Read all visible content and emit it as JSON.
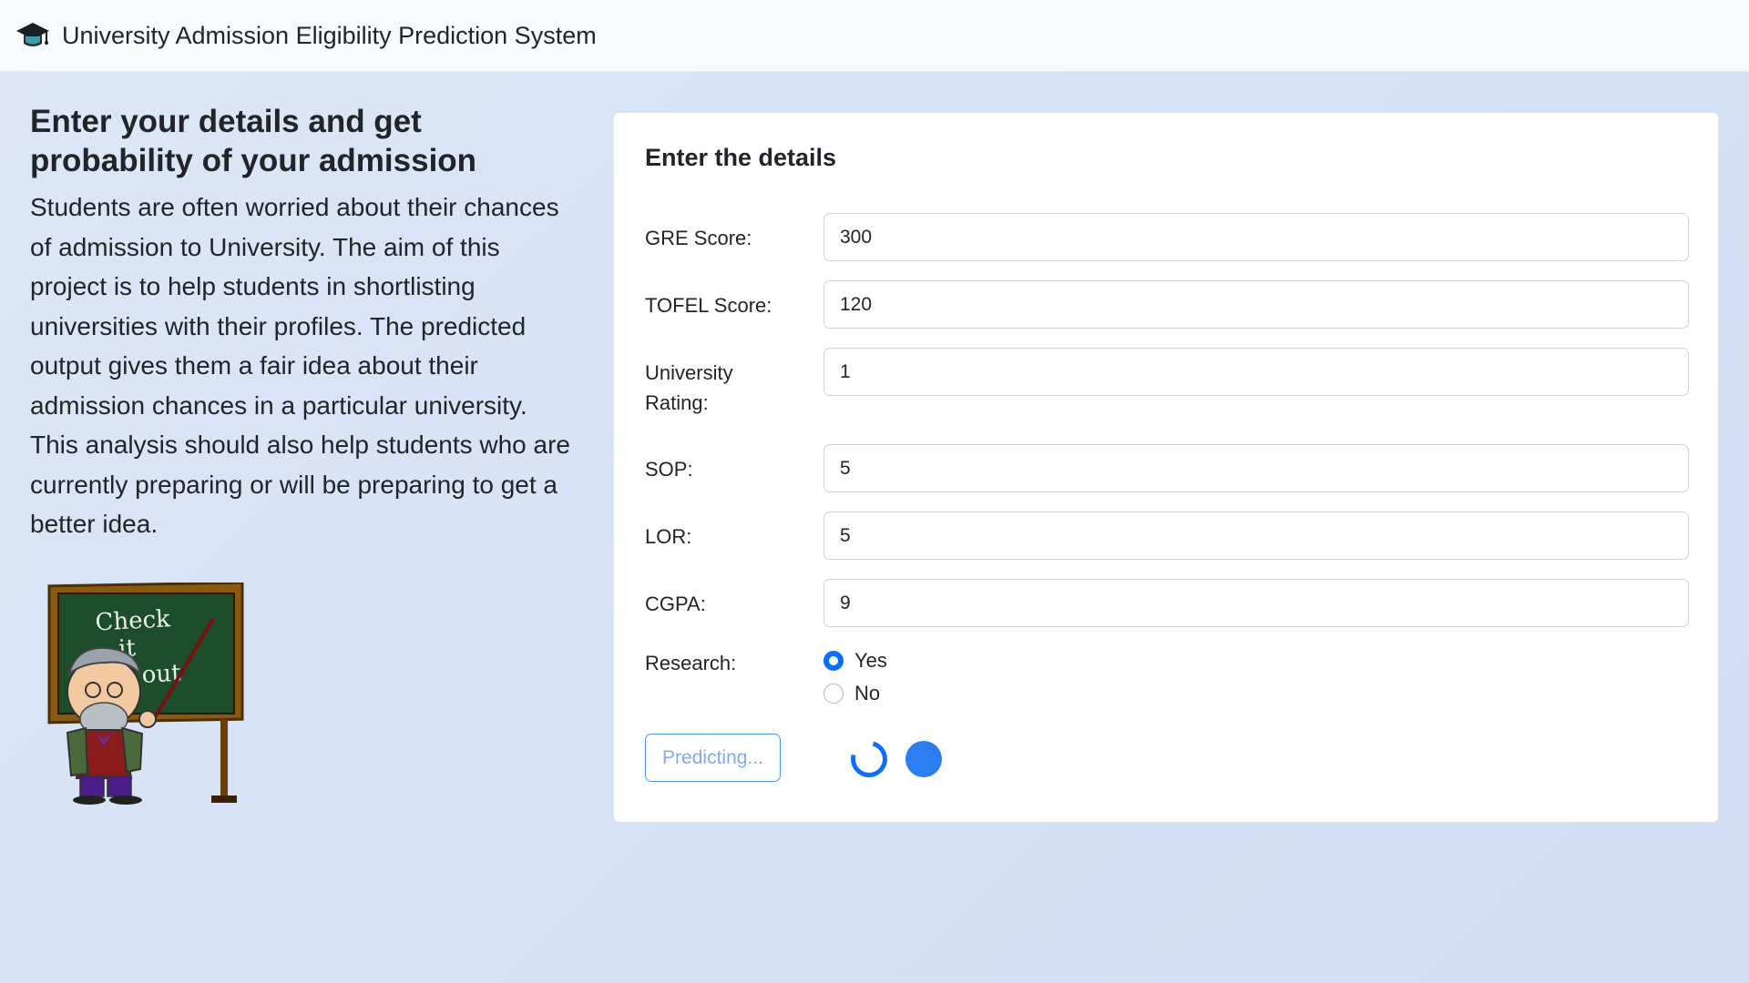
{
  "header": {
    "icon": "graduation-cap-icon",
    "title": "University Admission Eligibility Prediction System"
  },
  "intro": {
    "heading": "Enter your details and get probability of your admission",
    "paragraph": "Students are often worried about their chances of admission to University. The aim of this project is to help students in shortlisting universities with their profiles. The predicted output gives them a fair idea about their admission chances in a particular university. This analysis should also help students who are currently preparing or will be preparing to get a better idea.",
    "illustration": "teacher-chalkboard-illustration",
    "chalkboard_text": "Check it out"
  },
  "form": {
    "title": "Enter the details",
    "fields": {
      "gre": {
        "label": "GRE Score:",
        "value": "300"
      },
      "tofel": {
        "label": "TOFEL Score:",
        "value": "120"
      },
      "rating": {
        "label": "University Rating:",
        "value": "1"
      },
      "sop": {
        "label": "SOP:",
        "value": "5"
      },
      "lor": {
        "label": "LOR:",
        "value": "5"
      },
      "cgpa": {
        "label": "CGPA:",
        "value": "9"
      }
    },
    "research": {
      "label": "Research:",
      "options": [
        "Yes",
        "No"
      ],
      "selected": "Yes"
    },
    "submit_label": "Predicting...",
    "loading": true
  },
  "colors": {
    "primary": "#0d6efd",
    "navbar_bg": "#f8f9fa",
    "page_bg": "#d6e2f5"
  }
}
